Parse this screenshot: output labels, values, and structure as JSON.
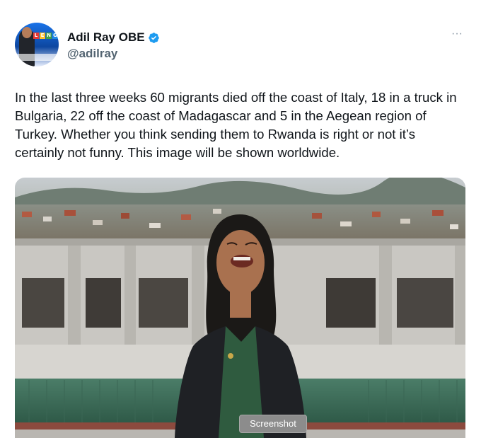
{
  "tweet": {
    "author": {
      "display_name": "Adil Ray OBE",
      "handle": "@adilray",
      "verified": true,
      "avatar_tiles": [
        "L",
        "E",
        "N",
        "G"
      ]
    },
    "more_label": "···",
    "text": "In the last three weeks 60 migrants died off the coast of Italy, 18 in a truck in Bulgaria, 22 off the coast of Madagascar and 5 in the Aegean region of Turkey. Whether you think sending them to Rwanda is right or not it’s certainly not funny. This image will be shown worldwide.",
    "media": {
      "type": "photo"
    },
    "screenshot_label": "Screenshot"
  },
  "colors": {
    "text": "#0f1419",
    "secondary_text": "#536471",
    "verified_blue": "#1d9bf0",
    "jacket": "#1f2125",
    "blouse": "#2f5b3f",
    "roof_green": "#3e6e5a"
  },
  "icons": {
    "verified": "verified-badge-icon",
    "more": "more-icon"
  }
}
